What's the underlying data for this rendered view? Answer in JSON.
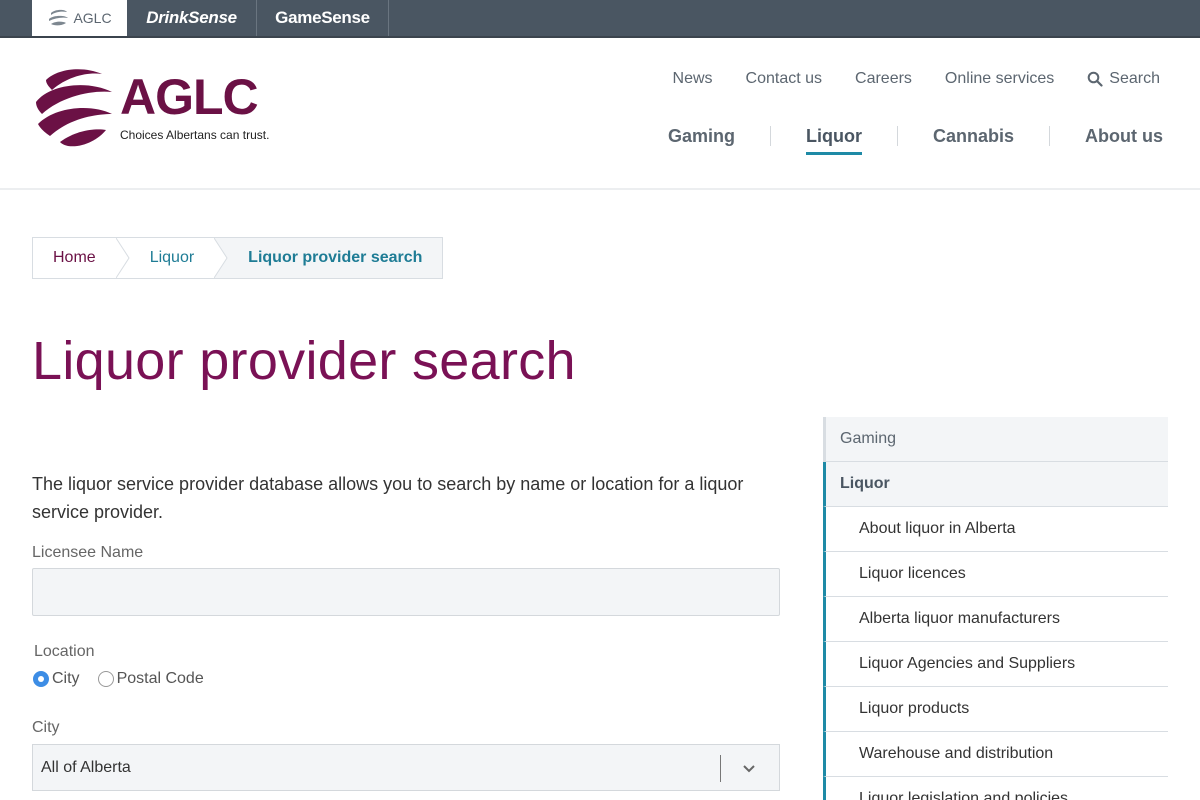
{
  "brandbar": {
    "tabs": [
      {
        "label": "AGLC"
      },
      {
        "label": "DrinkSense"
      },
      {
        "label": "GameSense"
      }
    ]
  },
  "logo": {
    "name": "AGLC",
    "tagline": "Choices Albertans can trust."
  },
  "utility_nav": {
    "items": [
      "News",
      "Contact us",
      "Careers",
      "Online services"
    ],
    "search_label": "Search",
    "search_icon": "search-icon"
  },
  "main_nav": {
    "items": [
      "Gaming",
      "Liquor",
      "Cannabis",
      "About us"
    ],
    "active": "Liquor"
  },
  "breadcrumb": {
    "items": [
      "Home",
      "Liquor",
      "Liquor provider search"
    ]
  },
  "page": {
    "title": "Liquor provider search",
    "intro": "The liquor service provider database allows you to search by name or location for a liquor service provider."
  },
  "form": {
    "licensee_label": "Licensee Name",
    "licensee_value": "",
    "location_label": "Location",
    "location_options": [
      "City",
      "Postal Code"
    ],
    "location_selected": "City",
    "city_label": "City",
    "city_value": "All of Alberta"
  },
  "sidenav": {
    "top_item": "Gaming",
    "parent_item": "Liquor",
    "children": [
      "About liquor in Alberta",
      "Liquor licences",
      "Alberta liquor manufacturers",
      "Liquor Agencies and Suppliers",
      "Liquor products",
      "Warehouse and distribution",
      "Liquor legislation and policies"
    ]
  },
  "colors": {
    "brand": "#6b1145",
    "title": "#7a1155",
    "accent": "#1e8aa6",
    "topbar": "#4a5662",
    "radio": "#3d8de5"
  }
}
